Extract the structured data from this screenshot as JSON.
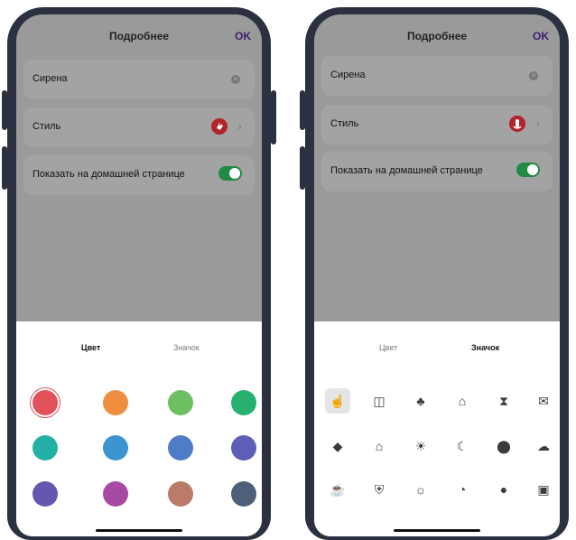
{
  "header": {
    "title": "Подробнее",
    "ok": "OK"
  },
  "fields": {
    "name_value": "Сирена",
    "style_label": "Стиль",
    "show_home_label": "Показать на домашней странице",
    "show_home_on": true
  },
  "tabs": {
    "color": "Цвет",
    "icon": "Значок"
  },
  "colors": {
    "selected": "#dc4f5a",
    "toggle": "#1f8b43",
    "badge": "#b3232b",
    "ok_text": "#3b1e6a"
  },
  "color_swatches": [
    "#e2505a",
    "#ef8e3f",
    "#6cc062",
    "#27b06f",
    "#22b0a7",
    "#3c95d1",
    "#4f7cc7",
    "#5d5fb7",
    "#6756b0",
    "#a84aa4",
    "#ba7c68",
    "#4e5f78"
  ],
  "icons": [
    "touch-icon",
    "curtains-icon",
    "palm-tree-icon",
    "person-home-icon",
    "hourglass-icon",
    "mail-icon",
    "tag-icon",
    "person-home-icon",
    "sun-low-icon",
    "moon-icon",
    "location-icon",
    "rain-cloud-icon",
    "cup-icon",
    "shield-icon",
    "sun-icon",
    "timer-icon",
    "drop-icon",
    "briefcase-icon"
  ]
}
